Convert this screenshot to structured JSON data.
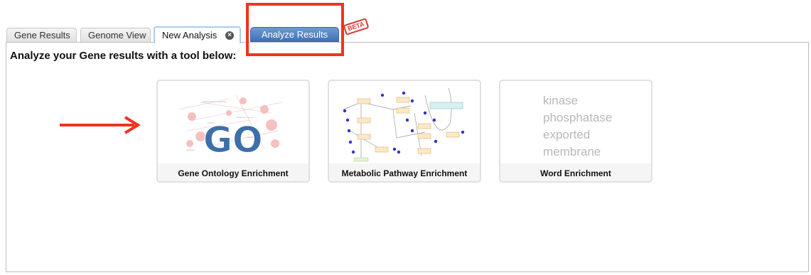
{
  "tabs": {
    "gene_results": "Gene Results",
    "genome_view": "Genome View",
    "new_analysis": "New Analysis",
    "new_analysis_close": "×",
    "analyze_results": "Analyze Results",
    "beta": "BETA"
  },
  "main": {
    "heading": "Analyze your Gene results with a tool below:"
  },
  "tools": [
    {
      "label": "Gene Ontology Enrichment",
      "thumb_text": "GO"
    },
    {
      "label": "Metabolic Pathway Enrichment"
    },
    {
      "label": "Word Enrichment",
      "thumb_words": [
        "kinase",
        "phosphatase",
        "exported",
        "membrane"
      ]
    }
  ],
  "colors": {
    "highlight": "#f0331f",
    "accent_tab": "#4a7cbf",
    "go_text": "#3d6fa8"
  }
}
